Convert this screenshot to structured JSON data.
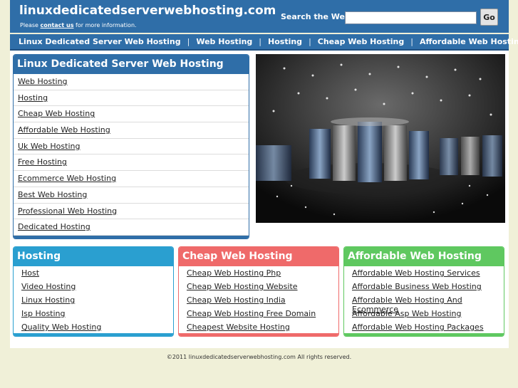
{
  "header": {
    "site_title": "linuxdedicatedserverwebhosting.com",
    "please_prefix": "Please ",
    "contact_link": "contact us",
    "please_suffix": " for more information.",
    "search_label": "Search the Web:",
    "search_value": "",
    "go_label": "Go"
  },
  "nav": {
    "items": [
      "Linux Dedicated Server Web Hosting",
      "Web Hosting",
      "Hosting",
      "Cheap Web Hosting",
      "Affordable Web Hosting"
    ],
    "separator": "|"
  },
  "main_box": {
    "title": "Linux Dedicated Server Web Hosting",
    "links": [
      "Web Hosting",
      "Hosting",
      "Cheap Web Hosting",
      "Affordable Web Hosting",
      "Uk Web Hosting",
      "Free Hosting",
      "Ecommerce Web Hosting",
      "Best Web Hosting",
      "Professional Web Hosting",
      "Dedicated Hosting"
    ]
  },
  "columns": [
    {
      "title": "Hosting",
      "links": [
        "Host",
        "Video Hosting",
        "Linux Hosting",
        "Isp Hosting",
        "Quality Web Hosting"
      ]
    },
    {
      "title": "Cheap Web Hosting",
      "links": [
        "Cheap Web Hosting Php",
        "Cheap Web Hosting Website",
        "Cheap Web Hosting India",
        "Cheap Web Hosting Free Domain",
        "Cheapest Website Hosting"
      ]
    },
    {
      "title": "Affordable Web Hosting",
      "links": [
        "Affordable Web Hosting Services",
        "Affordable Business Web Hosting",
        "Affordable Web Hosting And Ecommerce",
        "Affordable Asp Web Hosting",
        "Affordable Web Hosting Packages"
      ]
    }
  ],
  "footer": {
    "text": "©2011 linuxdedicatedserverwebhosting.com All rights reserved."
  },
  "colors": {
    "brand_blue": "#2f6ea8",
    "hosting_blue": "#2a9fd0",
    "cheap_red": "#ef6a6a",
    "afford_green": "#5fc860",
    "page_bg": "#f0f0d8"
  }
}
